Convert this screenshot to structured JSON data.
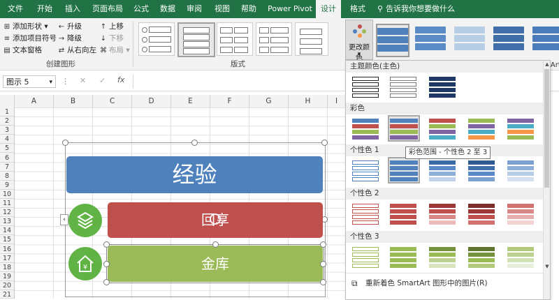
{
  "tabs": [
    "文件",
    "开始",
    "插入",
    "页面布局",
    "公式",
    "数据",
    "审阅",
    "视图",
    "帮助",
    "Power Pivot",
    "设计",
    "格式"
  ],
  "active_tab": "设计",
  "tell_me": "告诉我你想要做什么",
  "ribbon": {
    "create_graphic": {
      "add_shape": "添加形状",
      "add_bullet": "添加项目符号",
      "text_pane": "文本窗格",
      "promote": "升级",
      "demote": "降级",
      "right_to_left": "从右向左",
      "move_up": "上移",
      "move_down": "下移",
      "layout": "布局",
      "label": "创建图形"
    },
    "layouts_label": "版式",
    "change_colors": "更改颜色",
    "partial_right": "tArt"
  },
  "formula_bar": {
    "name_box": "图示 5",
    "cancel": "✕",
    "enter": "✓",
    "fx": "fx"
  },
  "columns": [
    "A",
    "B",
    "C",
    "D",
    "E",
    "F",
    "G",
    "H",
    "I"
  ],
  "rows": [
    "1",
    "2",
    "3",
    "4",
    "5",
    "6",
    "7",
    "8",
    "9",
    "10",
    "11",
    "12",
    "13",
    "14",
    "15",
    "16",
    "17",
    "18",
    "19",
    "20",
    "21"
  ],
  "smartart": {
    "title": "经验",
    "item1": "回享",
    "item2": "金库",
    "expand_arrow": "‹"
  },
  "panel": {
    "section_primary": "主题颜色(主色)",
    "section_colorful": "彩色",
    "section_accent1": "个性色 1",
    "section_accent2": "个性色 2",
    "section_accent3": "个性色 3",
    "tooltip": "彩色范围 - 个性色 2 至 3",
    "recolor": "重新着色 SmartArt 图形中的图片(R)"
  },
  "colors": {
    "excel_green": "#217346",
    "blue": "#4f81bd",
    "red": "#c0504d",
    "green": "#9bbb59",
    "purple": "#8064a2",
    "teal": "#4bacc6",
    "orange": "#f79646"
  },
  "icons": [
    "add-shape-icon",
    "add-bullet-icon",
    "text-pane-icon",
    "promote-icon",
    "demote-icon",
    "right-to-left-icon",
    "move-up-icon",
    "move-down-icon",
    "layout-icon",
    "search-icon",
    "layers-icon",
    "house-yen-icon",
    "palette-icon",
    "picture-icon"
  ]
}
